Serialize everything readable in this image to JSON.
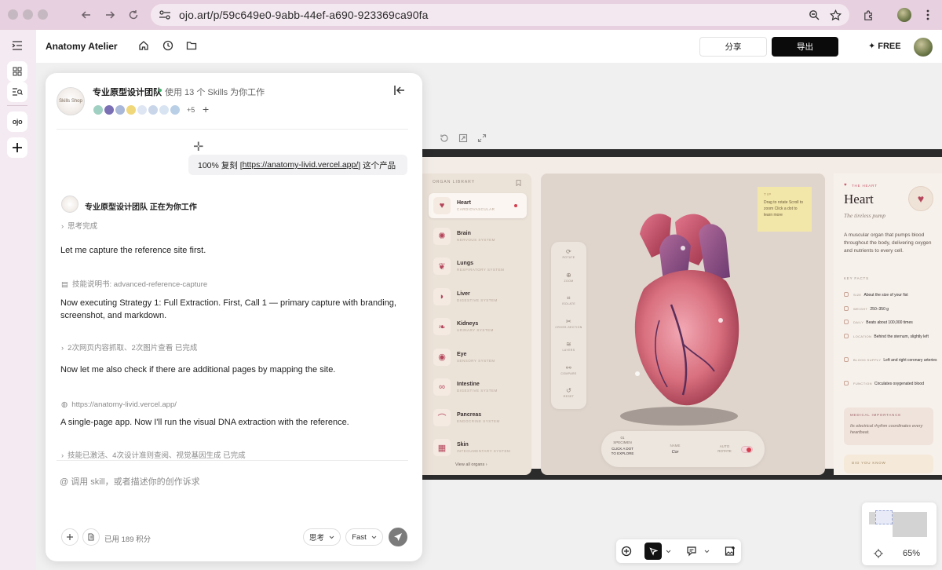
{
  "browser": {
    "url": "ojo.art/p/59c649e0-9abb-44ef-a690-923369ca90fa"
  },
  "app": {
    "name": "Anatomy Atelier",
    "share_label": "分享",
    "export_label": "导出",
    "plan_label": "✦ FREE"
  },
  "rail": {
    "brand_label": "ojo"
  },
  "chat": {
    "team_logo_text": "Skills Shop",
    "team_name": "专业原型设计团队",
    "team_status": "使用 13 个 Skills 为你工作",
    "skill_extra_count": "+5",
    "user_message_prefix": "100% 复刻 [",
    "user_message_link": "https://anatomy-livid.vercel.app/",
    "user_message_suffix": "] 这个产品",
    "working_label": "专业原型设计团队 正在为你工作",
    "steps": [
      {
        "kind": "status",
        "text": "思考完成"
      },
      {
        "kind": "text",
        "text": "Let me capture the reference site first."
      },
      {
        "kind": "status",
        "text": "技能说明书: advanced-reference-capture"
      },
      {
        "kind": "text",
        "text": "Now executing Strategy 1: Full Extraction. First, Call 1 — primary capture with branding, screenshot, and markdown."
      },
      {
        "kind": "status",
        "text": "2次网页内容抓取、2次图片查看 已完成"
      },
      {
        "kind": "text",
        "text": "Now let me also check if there are additional pages by mapping the site."
      },
      {
        "kind": "status",
        "text": "https://anatomy-livid.vercel.app/"
      },
      {
        "kind": "text",
        "text": "A single-page app. Now I'll run the visual DNA extraction with the reference."
      },
      {
        "kind": "status",
        "text": "技能已激活、4次设计准则查阅、视觉基因生成 已完成"
      }
    ],
    "input_placeholder": "@ 调用 skill，或者描述你的创作诉求",
    "credits_used": "已用 189 积分",
    "mode_label": "思考",
    "speed_label": "Fast"
  },
  "preview": {
    "library_title": "ORGAN LIBRARY",
    "organs": [
      {
        "name": "Heart",
        "system": "CARDIOVASCULAR",
        "icon": "♥"
      },
      {
        "name": "Brain",
        "system": "NERVOUS SYSTEM",
        "icon": "✺"
      },
      {
        "name": "Lungs",
        "system": "RESPIRATORY SYSTEM",
        "icon": "❦"
      },
      {
        "name": "Liver",
        "system": "DIGESTIVE SYSTEM",
        "icon": "◗"
      },
      {
        "name": "Kidneys",
        "system": "URINARY SYSTEM",
        "icon": "❧"
      },
      {
        "name": "Eye",
        "system": "SENSORY SYSTEM",
        "icon": "◉"
      },
      {
        "name": "Intestine",
        "system": "DIGESTIVE SYSTEM",
        "icon": "∞"
      },
      {
        "name": "Pancreas",
        "system": "ENDOCRINE SYSTEM",
        "icon": "⌒"
      },
      {
        "name": "Skin",
        "system": "INTEGUMENTARY SYSTEM",
        "icon": "▦"
      }
    ],
    "view_all": "View all organs  ›",
    "tools": [
      "ROTATE",
      "ZOOM",
      "ISOLATE",
      "CROSS-SECTION",
      "LAYERS",
      "COMPARE",
      "RESET"
    ],
    "tip_title": "TIP",
    "tip_text": "Drag to rotate Scroll to zoom Click a dot to learn more",
    "bar_specimen_no": "01",
    "bar_specimen": "SPECIMEN",
    "bar_cta": "CLICK A DOT TO EXPLORE",
    "bar_name_label": "NAME",
    "bar_name_value": "Cor",
    "bar_auto_rotate": "AUTO ROTATE",
    "info_tag": "THE HEART",
    "info_title": "Heart",
    "info_subtitle": "The tireless pump",
    "info_desc": "A muscular organ that pumps blood throughout the body, delivering oxygen and nutrients to every cell.",
    "key_facts_title": "KEY FACTS",
    "facts": [
      {
        "key": "SIZE",
        "value": "About the size of your fist"
      },
      {
        "key": "WEIGHT",
        "value": "250–350 g"
      },
      {
        "key": "DAILY",
        "value": "Beats about 100,000 times"
      },
      {
        "key": "LOCATION",
        "value": "Behind the sternum, slightly left"
      },
      {
        "key": "BLOOD SUPPLY",
        "value": "Left and right coronary arteries"
      },
      {
        "key": "FUNCTION",
        "value": "Circulates oxygenated blood"
      }
    ],
    "medical_title": "MEDICAL IMPORTANCE",
    "medical_text": "Its electrical rhythm coordinates every heartbeat.",
    "did_you_know": "DID YOU KNOW"
  },
  "canvas": {
    "zoom": "65%"
  }
}
